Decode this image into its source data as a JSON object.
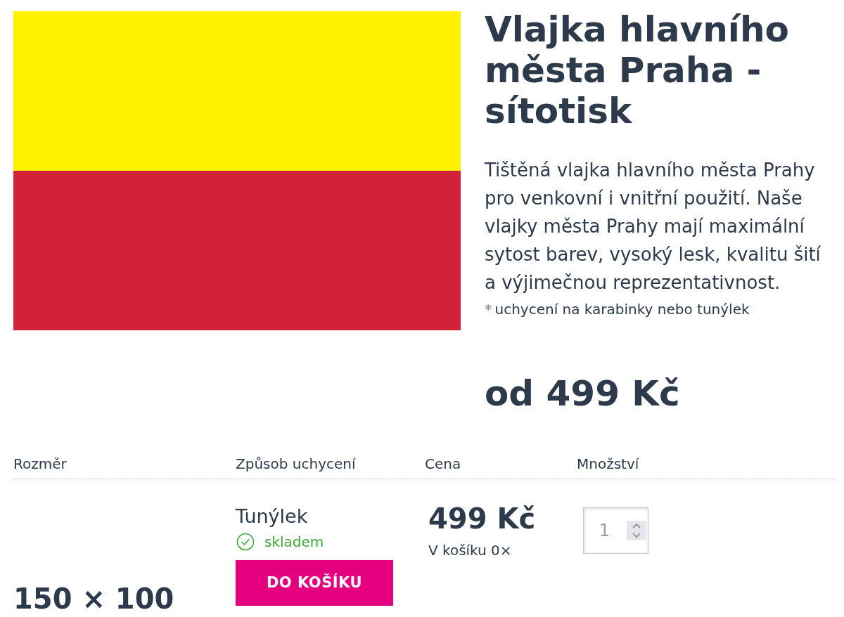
{
  "product": {
    "title": "Vlajka hlavního města Praha - sítotisk",
    "description": "Tištěná vlajka hlavního města Prahy pro venkovní i vnitřní použití. Naše vlajky města Prahy mají maximální sytost barev, vysoký lesk, kvalitu šití a výjimečnou reprezentativnost.",
    "footnote": {
      "mark": "*",
      "text": "uchycení na karabinky nebo tunýlek"
    },
    "price": "od 499 Kč"
  },
  "variants_table": {
    "columns": [
      "Rozměr",
      "Způsob uchycení",
      "Cena",
      "Množství"
    ],
    "rows": [
      {
        "size": "150 × 100",
        "mounting": "Tunýlek",
        "stock": "skladem",
        "button": "DO KOŠÍKU",
        "price": "499 Kč",
        "cart": "V košíku 0×",
        "quantity": "1"
      }
    ]
  }
}
